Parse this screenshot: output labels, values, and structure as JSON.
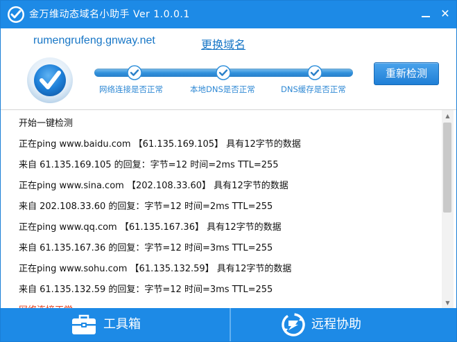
{
  "window": {
    "title": "金万维动态域名小助手 Ver 1.0.0.1",
    "minimize_glyph": "",
    "close_glyph": "✕"
  },
  "header": {
    "domain": "rumengrufeng.gnway.net",
    "change_domain_label": "更换域名",
    "recheck_label": "重新检测"
  },
  "steps": [
    {
      "label": "网络连接是否正常",
      "status": "ok"
    },
    {
      "label": "本地DNS是否正常",
      "status": "ok"
    },
    {
      "label": "DNS缓存是否正常",
      "status": "ok"
    }
  ],
  "log": {
    "lines": [
      "开始一键检测",
      "正在ping www.baidu.com 【61.135.169.105】 具有12字节的数据",
      "来自 61.135.169.105 的回复：字节=12 时间=2ms TTL=255",
      "正在ping www.sina.com 【202.108.33.60】 具有12字节的数据",
      "来自 202.108.33.60 的回复：字节=12 时间=2ms TTL=255",
      "正在ping www.qq.com 【61.135.167.36】 具有12字节的数据",
      "来自 61.135.167.36 的回复：字节=12 时间=3ms TTL=255",
      "正在ping www.sohu.com 【61.135.132.59】 具有12字节的数据",
      "来自 61.135.132.59 的回复：字节=12 时间=3ms TTL=255"
    ],
    "result": "网络连接正常",
    "result_color": "#e5431f"
  },
  "bottom": {
    "toolbox_label": "工具箱",
    "remote_label": "远程协助"
  },
  "icons": {
    "app": "app-logo-icon",
    "status": "check-shield-icon",
    "step": "check-circle-icon",
    "toolbox": "toolbox-icon",
    "remote": "remote-assist-icon"
  },
  "colors": {
    "titlebar": "#1d8ae6",
    "accent": "#1776c6",
    "step_label": "#2e88d4"
  }
}
